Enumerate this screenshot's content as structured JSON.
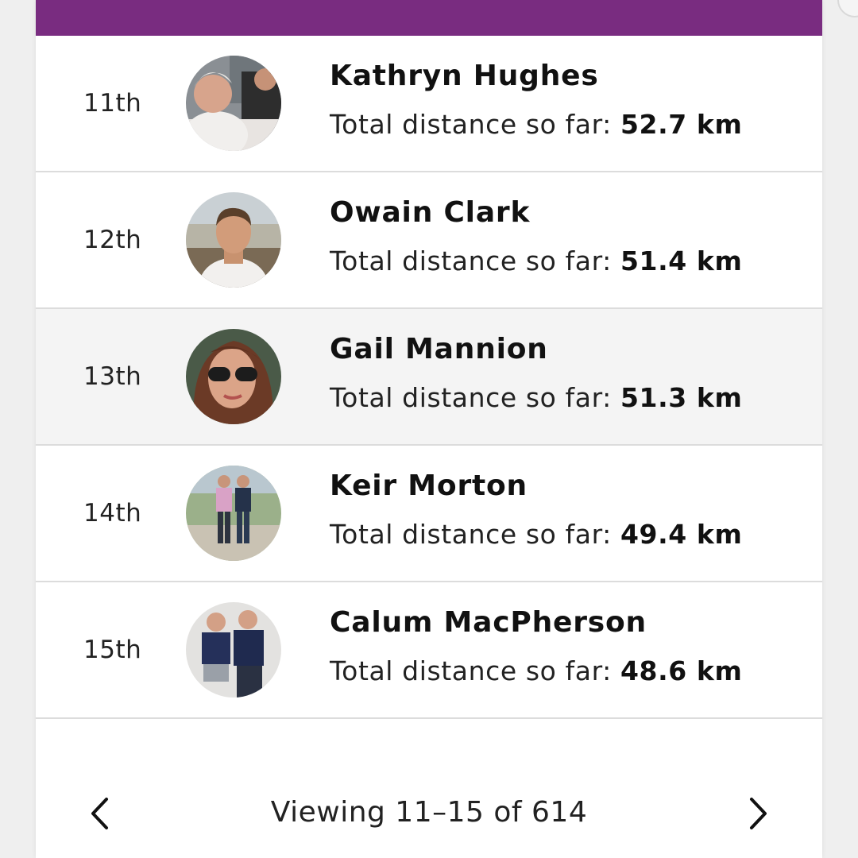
{
  "theme": {
    "header_color": "#792c80"
  },
  "leaderboard": {
    "entries": [
      {
        "rank": "11th",
        "name": "Kathryn Hughes",
        "distance_label": "Total distance so far:",
        "distance_value": "52.7 km",
        "avatar": "avatar-photo",
        "highlighted": false
      },
      {
        "rank": "12th",
        "name": "Owain Clark",
        "distance_label": "Total distance so far:",
        "distance_value": "51.4 km",
        "avatar": "avatar-photo",
        "highlighted": false
      },
      {
        "rank": "13th",
        "name": "Gail Mannion",
        "distance_label": "Total distance so far:",
        "distance_value": "51.3 km",
        "avatar": "avatar-photo",
        "highlighted": true
      },
      {
        "rank": "14th",
        "name": "Keir Morton",
        "distance_label": "Total distance so far:",
        "distance_value": "49.4 km",
        "avatar": "avatar-photo",
        "highlighted": false
      },
      {
        "rank": "15th",
        "name": "Calum MacPherson",
        "distance_label": "Total distance so far:",
        "distance_value": "48.6 km",
        "avatar": "avatar-photo",
        "highlighted": false
      }
    ]
  },
  "pagination": {
    "label": "Viewing 11–15 of 614",
    "prev_icon": "chevron-left-icon",
    "next_icon": "chevron-right-icon"
  }
}
